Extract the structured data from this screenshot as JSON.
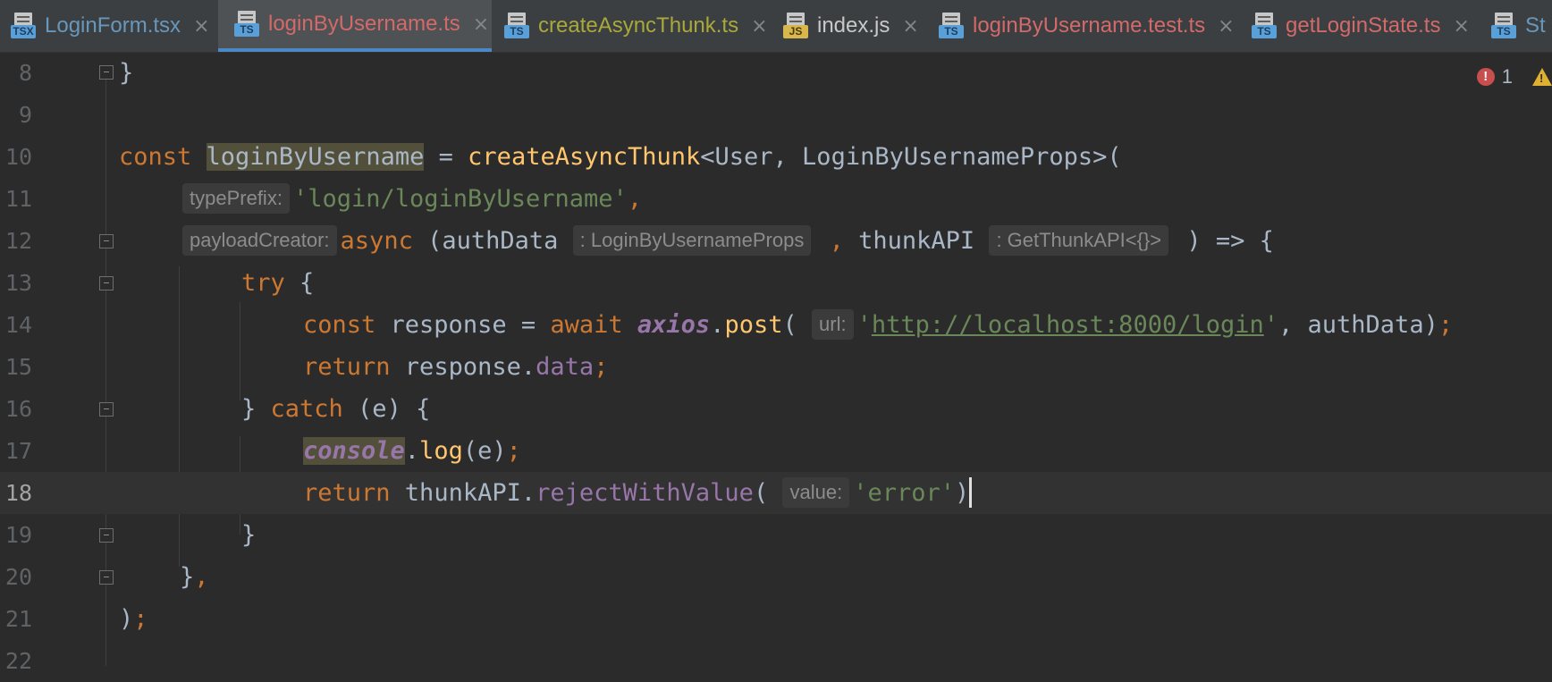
{
  "tabs": [
    {
      "label": "LoginForm.tsx",
      "badge": "TSX",
      "type": "tsx",
      "color": "#6897bb",
      "active": false
    },
    {
      "label": "loginByUsername.ts",
      "badge": "TS",
      "type": "ts",
      "color": "#d26a6a",
      "active": true
    },
    {
      "label": "createAsyncThunk.ts",
      "badge": "TS",
      "type": "ts",
      "color": "#a9a83a",
      "active": false
    },
    {
      "label": "index.js",
      "badge": "JS",
      "type": "js",
      "color": "#c8c8c8",
      "active": false
    },
    {
      "label": "loginByUsername.test.ts",
      "badge": "TS",
      "type": "ts",
      "color": "#d26a6a",
      "active": false
    },
    {
      "label": "getLoginState.ts",
      "badge": "TS",
      "type": "ts",
      "color": "#d26a6a",
      "active": false
    },
    {
      "label": "St",
      "badge": "TS",
      "type": "ts",
      "color": "#6897bb",
      "active": false
    }
  ],
  "tab_close_glyph": "×",
  "inspections": {
    "errors": "1",
    "error_glyph": "!",
    "warning_glyph": "!"
  },
  "editor": {
    "current_line": "18",
    "lines": [
      {
        "num": "8",
        "t": [
          "}"
        ]
      },
      {
        "num": "9",
        "t": []
      },
      {
        "num": "10",
        "t": [
          "const",
          "loginByUsername",
          " = ",
          "createAsyncThunk",
          "<User, LoginByUsernameProps>("
        ]
      },
      {
        "num": "11",
        "t": [
          "typePrefix:",
          "'login/loginByUsername'",
          ","
        ]
      },
      {
        "num": "12",
        "t": [
          "payloadCreator:",
          "async",
          " (authData",
          ": LoginByUsernameProps",
          " , ",
          "thunkAPI",
          ": GetThunkAPI<{}>",
          " ) => {"
        ]
      },
      {
        "num": "13",
        "t": [
          "try",
          " {"
        ]
      },
      {
        "num": "14",
        "t": [
          "const",
          " response = ",
          "await",
          " ",
          "axios",
          ".",
          "post",
          "(",
          "url:",
          "'",
          "http://localhost:8000/login",
          "'",
          ", authData)",
          ";"
        ]
      },
      {
        "num": "15",
        "t": [
          "return",
          " response.",
          "data",
          ";"
        ]
      },
      {
        "num": "16",
        "t": [
          "} ",
          "catch",
          " (e) {"
        ]
      },
      {
        "num": "17",
        "t": [
          "console",
          ".",
          "log",
          "(e)",
          ";"
        ]
      },
      {
        "num": "18",
        "t": [
          "return",
          " thunkAPI.",
          "rejectWithValue",
          "(",
          "value:",
          "'error'",
          ")"
        ]
      },
      {
        "num": "19",
        "t": [
          "}"
        ]
      },
      {
        "num": "20",
        "t": [
          "}",
          ","
        ]
      },
      {
        "num": "21",
        "t": [
          ")",
          ";"
        ]
      },
      {
        "num": "22",
        "t": []
      }
    ]
  }
}
